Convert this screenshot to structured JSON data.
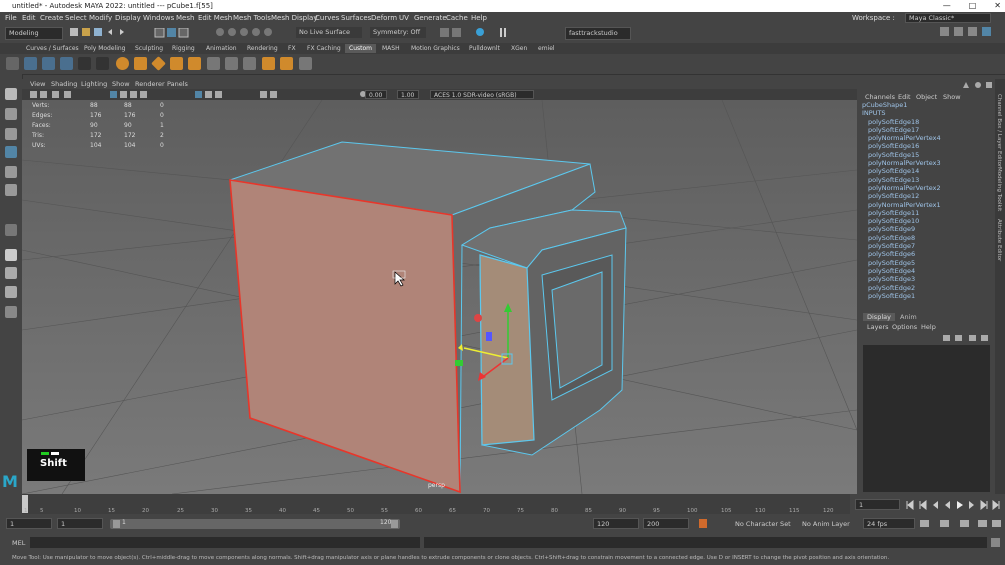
{
  "window": {
    "title": "untitled* - Autodesk MAYA 2022: untitled   ---   pCube1.f[55]",
    "controls": [
      "—",
      "□",
      "✕"
    ]
  },
  "menubar": {
    "items": [
      "File",
      "Edit",
      "Create",
      "Select",
      "Modify",
      "Display",
      "Windows",
      "Mesh",
      "Edit Mesh",
      "Mesh Tools",
      "Mesh Display",
      "Curves",
      "Surfaces",
      "Deform",
      "UV",
      "Generate",
      "Cache",
      "Help"
    ],
    "workspace_label": "Workspace :",
    "workspace_value": "Maya Classic*"
  },
  "statusline": {
    "menuset": "Modeling",
    "live_surface": "No Live Surface",
    "symmetry": "Symmetry: Off",
    "user": "fasttrackstudio"
  },
  "shelf": {
    "tabs": [
      "Curves / Surfaces",
      "Poly Modeling",
      "Sculpting",
      "Rigging",
      "Animation",
      "Rendering",
      "FX",
      "FX Caching",
      "Custom",
      "MASH",
      "Motion Graphics",
      "Pulldownlt",
      "XGen",
      "emiel"
    ],
    "active_tab": "Custom"
  },
  "viewport": {
    "menu": [
      "View",
      "Shading",
      "Lighting",
      "Show",
      "Renderer",
      "Panels"
    ],
    "exposure": "0.00",
    "gamma": "1.00",
    "colorspace": "ACES 1.0 SDR-video (sRGB)",
    "camera_label": "persp",
    "hud": [
      {
        "label": "Verts:",
        "a": "88",
        "b": "88",
        "c": "0"
      },
      {
        "label": "Edges:",
        "a": "176",
        "b": "176",
        "c": "0"
      },
      {
        "label": "Faces:",
        "a": "90",
        "b": "90",
        "c": "1"
      },
      {
        "label": "Tris:",
        "a": "172",
        "b": "172",
        "c": "2"
      },
      {
        "label": "UVs:",
        "a": "104",
        "b": "104",
        "c": "0"
      }
    ]
  },
  "channelbox": {
    "menu": [
      "Channels",
      "Edit",
      "Object",
      "Show"
    ],
    "shape": "pCubeShape1",
    "inputs_label": "INPUTS",
    "inputs": [
      "polySoftEdge18",
      "polySoftEdge17",
      "polyNormalPerVertex4",
      "polySoftEdge16",
      "polySoftEdge15",
      "polyNormalPerVertex3",
      "polySoftEdge14",
      "polySoftEdge13",
      "polyNormalPerVertex2",
      "polySoftEdge12",
      "polyNormalPerVertex1",
      "polySoftEdge11",
      "polySoftEdge10",
      "polySoftEdge9",
      "polySoftEdge8",
      "polySoftEdge7",
      "polySoftEdge6",
      "polySoftEdge5",
      "polySoftEdge4",
      "polySoftEdge3",
      "polySoftEdge2",
      "polySoftEdge1"
    ],
    "side_tabs": [
      "Channel Box / Layer Editor",
      "Modeling Toolkit",
      "Attribute Editor"
    ]
  },
  "layers": {
    "tabs": [
      "Display",
      "Anim"
    ],
    "menu": [
      "Layers",
      "Options",
      "Help"
    ]
  },
  "timeslider": {
    "ticks": [
      "1",
      "5",
      "10",
      "15",
      "20",
      "25",
      "30",
      "35",
      "40",
      "45",
      "50",
      "55",
      "60",
      "65",
      "70",
      "75",
      "80",
      "85",
      "90",
      "95",
      "100",
      "105",
      "110",
      "115",
      "120"
    ],
    "current_frame": "1"
  },
  "range": {
    "start": "1",
    "playback_start": "1",
    "range_start": "1",
    "range_end": "120",
    "playback_end": "120",
    "end": "200",
    "character_set": "No Character Set",
    "anim_layer": "No Anim Layer",
    "fps": "24 fps"
  },
  "commandline": {
    "label": "MEL"
  },
  "helpline": {
    "text": "Move Tool: Use manipulator to move object(s). Ctrl+middle-drag to move components along normals. Shift+drag manipulator axis or plane handles to extrude components or clone objects. Ctrl+Shift+drag to constrain movement to a connected edge. Use D or INSERT to change the pivot position and axis orientation."
  },
  "overlay": {
    "key_label": "Shift"
  },
  "colors": {
    "accent": "#5285a6",
    "selection": "#e8362a",
    "wire": "#5cc8ee"
  }
}
